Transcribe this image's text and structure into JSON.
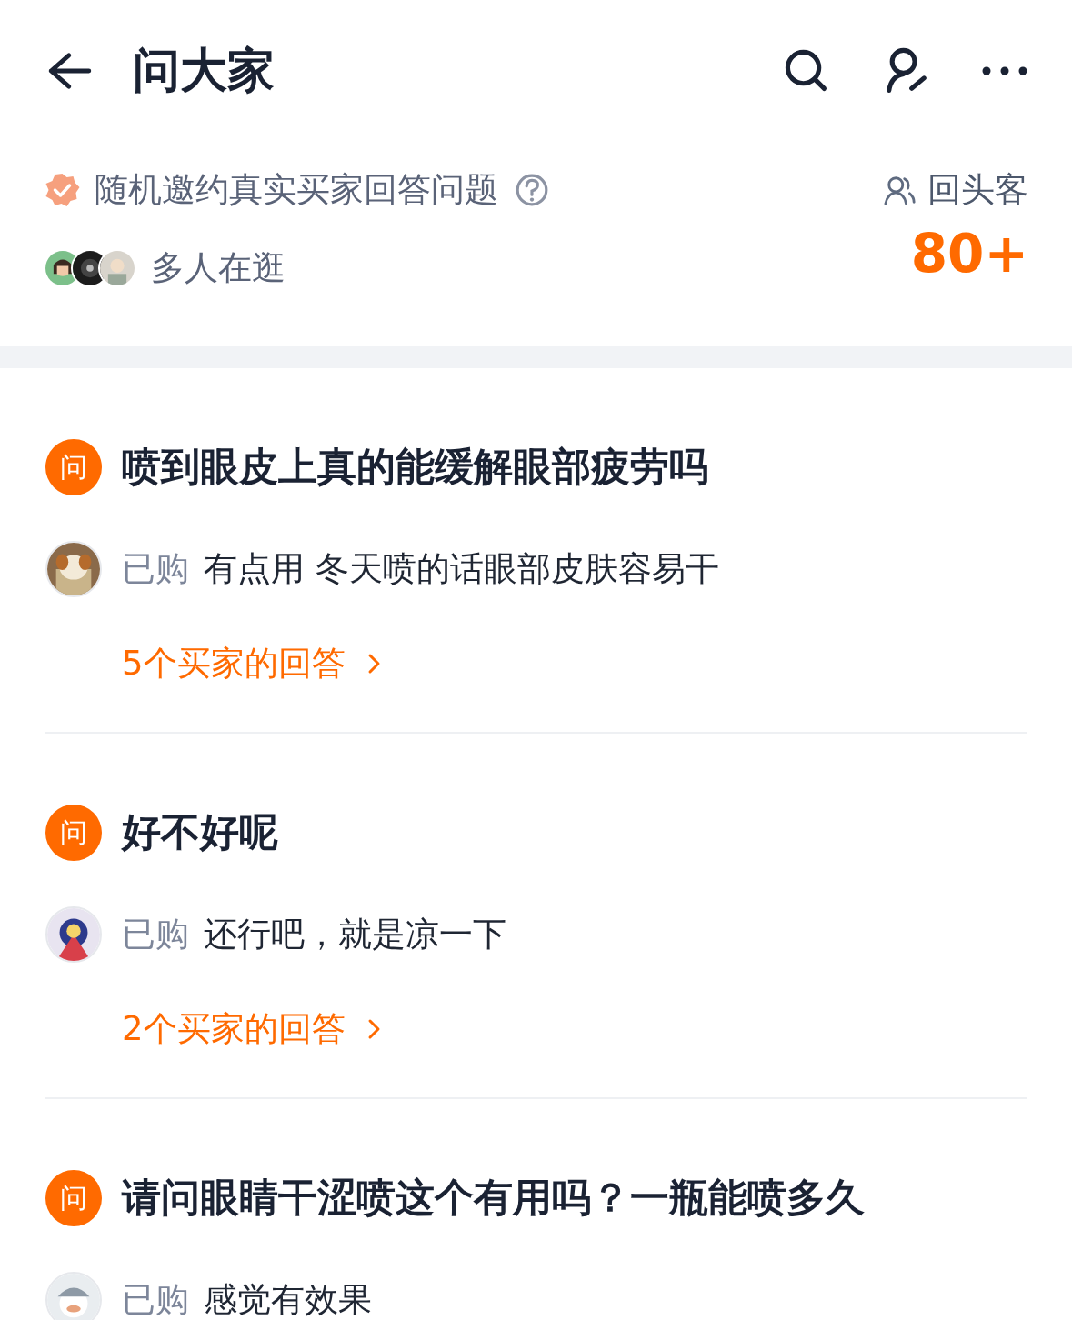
{
  "header": {
    "title": "问大家"
  },
  "invite": {
    "text": "随机邀约真实买家回答问题",
    "browsing": "多人在逛",
    "repeat_label": "回头客",
    "repeat_count": "80+"
  },
  "questions": [
    {
      "badge": "问",
      "title": "喷到眼皮上真的能缓解眼部疲劳吗",
      "answer_tag": "已购",
      "answer": "有点用 冬天喷的话眼部皮肤容易干",
      "link": "5个买家的回答"
    },
    {
      "badge": "问",
      "title": "好不好呢",
      "answer_tag": "已购",
      "answer": "还行吧，就是凉一下",
      "link": "2个买家的回答"
    },
    {
      "badge": "问",
      "title": "请问眼睛干涩喷这个有用吗？一瓶能喷多久",
      "answer_tag": "已购",
      "answer": "感觉有效果"
    }
  ]
}
